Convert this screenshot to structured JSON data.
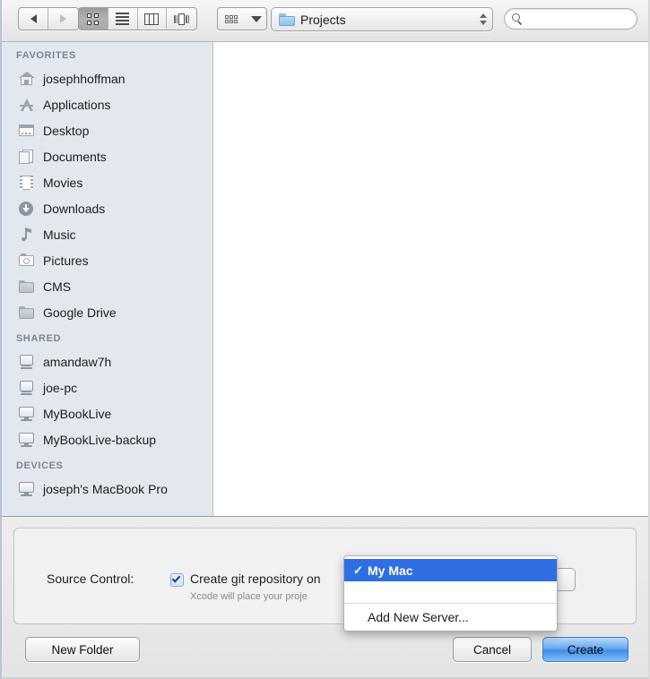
{
  "toolbar": {
    "nav": {
      "back_label": "Back",
      "forward_label": "Forward"
    },
    "view_modes": [
      {
        "name": "icon-view",
        "label": "Icon View",
        "selected": true
      },
      {
        "name": "list-view",
        "label": "List View",
        "selected": false
      },
      {
        "name": "column-view",
        "label": "Column View",
        "selected": false
      },
      {
        "name": "coverflow-view",
        "label": "Cover Flow View",
        "selected": false
      }
    ],
    "arrange_label": "Arrange",
    "location": {
      "label": "Projects",
      "icon": "blue-folder-icon"
    },
    "search": {
      "value": "",
      "placeholder": "",
      "icon": "search-icon"
    }
  },
  "sidebar": {
    "sections": [
      {
        "header": "FAVORITES",
        "items": [
          {
            "label": "josephhoffman",
            "icon": "home-icon"
          },
          {
            "label": "Applications",
            "icon": "applications-icon"
          },
          {
            "label": "Desktop",
            "icon": "desktop-icon"
          },
          {
            "label": "Documents",
            "icon": "documents-icon"
          },
          {
            "label": "Movies",
            "icon": "movies-icon"
          },
          {
            "label": "Downloads",
            "icon": "downloads-icon"
          },
          {
            "label": "Music",
            "icon": "music-icon"
          },
          {
            "label": "Pictures",
            "icon": "pictures-icon"
          },
          {
            "label": "CMS",
            "icon": "folder-icon"
          },
          {
            "label": "Google Drive",
            "icon": "folder-icon"
          }
        ]
      },
      {
        "header": "SHARED",
        "items": [
          {
            "label": "amandaw7h",
            "icon": "shared-computer-icon"
          },
          {
            "label": "joe-pc",
            "icon": "shared-computer-icon"
          },
          {
            "label": "MyBookLive",
            "icon": "display-icon"
          },
          {
            "label": "MyBookLive-backup",
            "icon": "display-icon"
          }
        ]
      },
      {
        "header": "DEVICES",
        "items": [
          {
            "label": "joseph's MacBook Pro",
            "icon": "display-icon"
          }
        ]
      }
    ]
  },
  "panel": {
    "source_control_label": "Source Control:",
    "checkbox": {
      "label": "Create git repository on",
      "checked": true
    },
    "helper_text": "Xcode will place your proje",
    "repo_menu": {
      "selected": "My Mac",
      "items": [
        {
          "label": "My Mac",
          "checked": true,
          "highlighted": true
        },
        {
          "label": "Add New Server...",
          "checked": false,
          "highlighted": false
        }
      ]
    },
    "buttons": {
      "new_folder": "New Folder",
      "cancel": "Cancel",
      "create": "Create"
    }
  },
  "colors": {
    "accent": "#2f6fe3",
    "default_button": "#3d8ee8",
    "sidebar_bg": "#e3e8ef",
    "sidebar_header": "#7b8694"
  }
}
